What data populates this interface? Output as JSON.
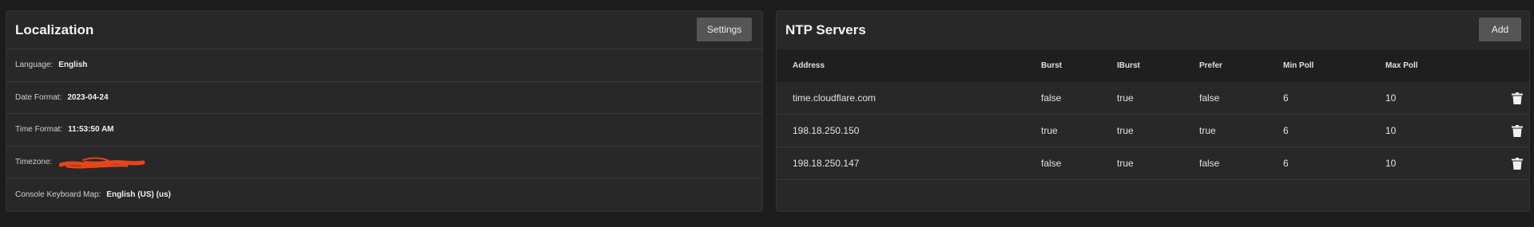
{
  "localization": {
    "title": "Localization",
    "settings_label": "Settings",
    "rows": [
      {
        "label": "Language:",
        "value": "English"
      },
      {
        "label": "Date Format:",
        "value": "2023-04-24"
      },
      {
        "label": "Time Format:",
        "value": "11:53:50 AM"
      },
      {
        "label": "Timezone:",
        "value": ""
      },
      {
        "label": "Console Keyboard Map:",
        "value": "English (US) (us)"
      }
    ]
  },
  "ntp": {
    "title": "NTP Servers",
    "add_label": "Add",
    "columns": [
      "Address",
      "Burst",
      "IBurst",
      "Prefer",
      "Min Poll",
      "Max Poll"
    ],
    "rows": [
      {
        "address": "time.cloudflare.com",
        "burst": "false",
        "iburst": "true",
        "prefer": "false",
        "min_poll": "6",
        "max_poll": "10"
      },
      {
        "address": "198.18.250.150",
        "burst": "true",
        "iburst": "true",
        "prefer": "true",
        "min_poll": "6",
        "max_poll": "10"
      },
      {
        "address": "198.18.250.147",
        "burst": "false",
        "iburst": "true",
        "prefer": "false",
        "min_poll": "6",
        "max_poll": "10"
      }
    ]
  },
  "colors": {
    "background": "#1c1c1c",
    "card": "#282828",
    "button": "#555555",
    "redaction": "#e8431b"
  },
  "icons": {
    "delete": "trash-icon"
  }
}
